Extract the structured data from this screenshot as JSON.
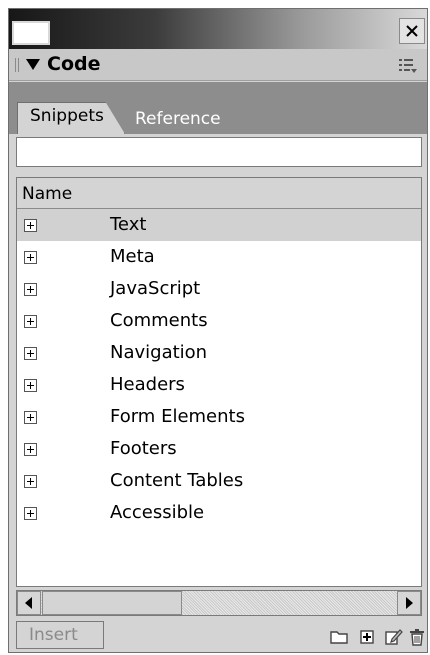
{
  "panel": {
    "title": "Code",
    "tabs": [
      {
        "label": "Snippets",
        "active": true
      },
      {
        "label": "Reference",
        "active": false
      }
    ],
    "description_value": ""
  },
  "list": {
    "header": "Name",
    "items": [
      {
        "label": "Text",
        "selected": true
      },
      {
        "label": "Meta"
      },
      {
        "label": "JavaScript"
      },
      {
        "label": "Comments"
      },
      {
        "label": "Navigation"
      },
      {
        "label": "Headers"
      },
      {
        "label": "Form Elements"
      },
      {
        "label": "Footers"
      },
      {
        "label": "Content Tables"
      },
      {
        "label": "Accessible"
      }
    ]
  },
  "toolbar": {
    "insert_label": "Insert",
    "icons": [
      "new-folder-icon",
      "new-snippet-icon",
      "edit-snippet-icon",
      "delete-icon"
    ]
  },
  "colors": {
    "selected_row": "#d1d1d1",
    "tab_strip": "#8d8d8d",
    "panel_bg": "#d4d4d4"
  }
}
